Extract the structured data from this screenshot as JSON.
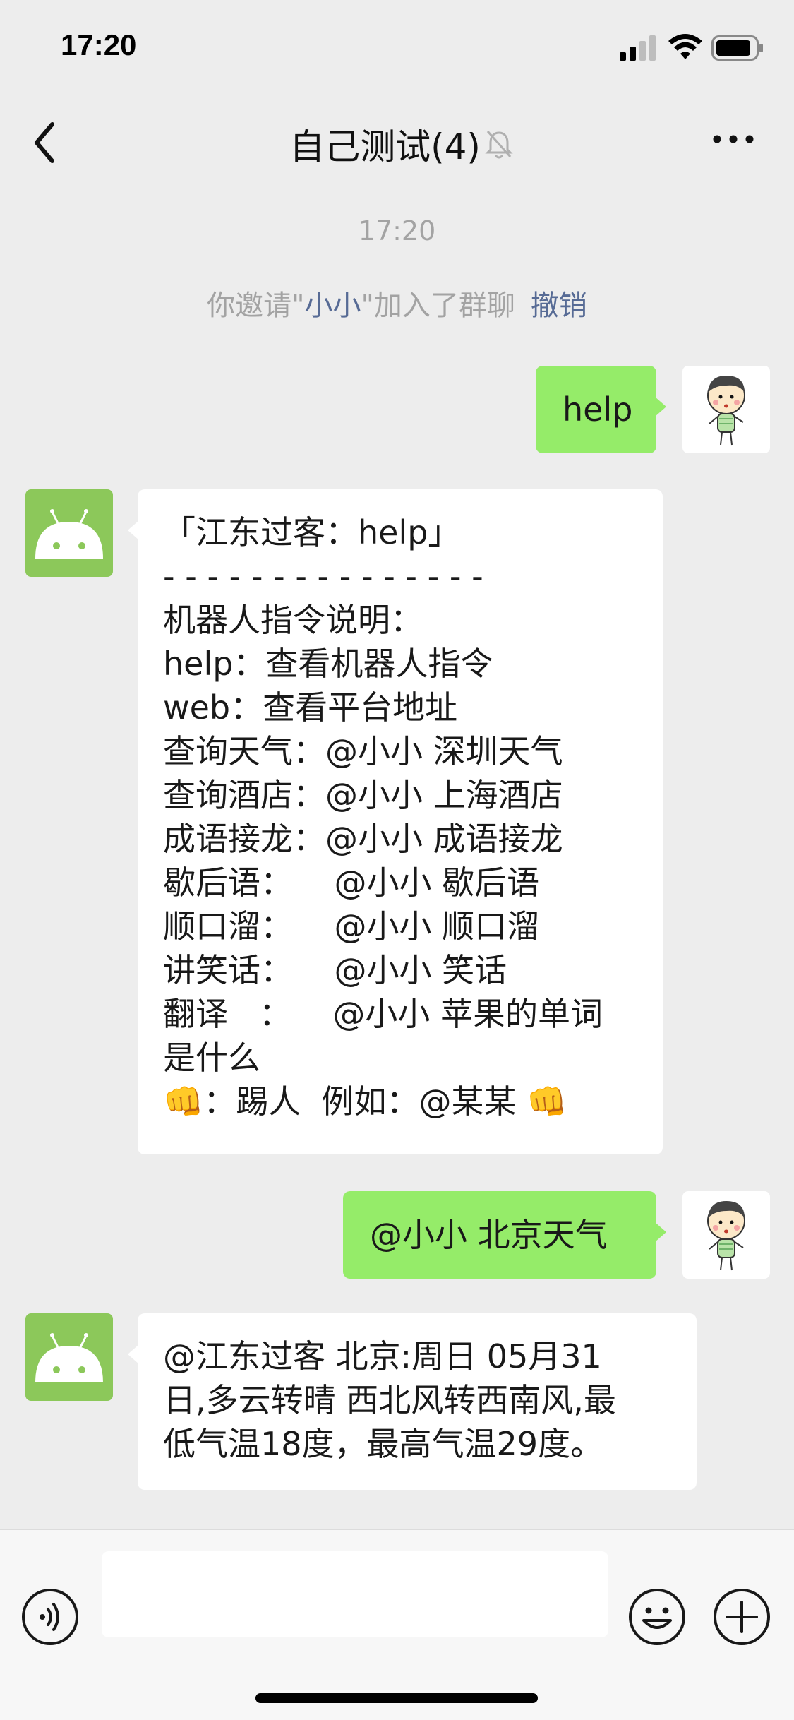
{
  "status_bar": {
    "time": "17:20"
  },
  "nav": {
    "title": "自己测试(4)"
  },
  "timestamp": "17:20",
  "system_message": {
    "prefix": "你邀请\"",
    "name": "小小",
    "suffix": "\"加入了群聊",
    "undo": "撤销"
  },
  "messages": [
    {
      "side": "right",
      "text": "help"
    },
    {
      "side": "left",
      "text": "「江东过客：help」\n- - - - - - - - - - - - - - -\n机器人指令说明：\nhelp：查看机器人指令\nweb：查看平台地址\n查询天气：@小小 深圳天气\n查询酒店：@小小 上海酒店\n成语接龙：@小小 成语接龙\n歇后语：    @小小 歇后语\n顺口溜：    @小小 顺口溜\n讲笑话：    @小小 笑话\n翻译   ：    @小小 苹果的单词\n是什么\n👊：踢人  例如：@某某 👊"
    },
    {
      "side": "right",
      "text": "@小小 北京天气"
    },
    {
      "side": "left",
      "text": "@江东过客 北京:周日 05月31\n日,多云转晴 西北风转西南风,最\n低气温18度，最高气温29度。"
    }
  ],
  "colors": {
    "background": "#ededed",
    "bubble_self": "#95ec69",
    "bubble_other": "#ffffff",
    "link": "#576b95",
    "robot_avatar": "#8cc85a"
  },
  "icons": {
    "back": "chevron-left-icon",
    "mute": "bell-slash-icon",
    "more": "ellipsis-icon",
    "voice": "voice-icon",
    "emoji": "smiley-icon",
    "plus": "plus-icon"
  }
}
